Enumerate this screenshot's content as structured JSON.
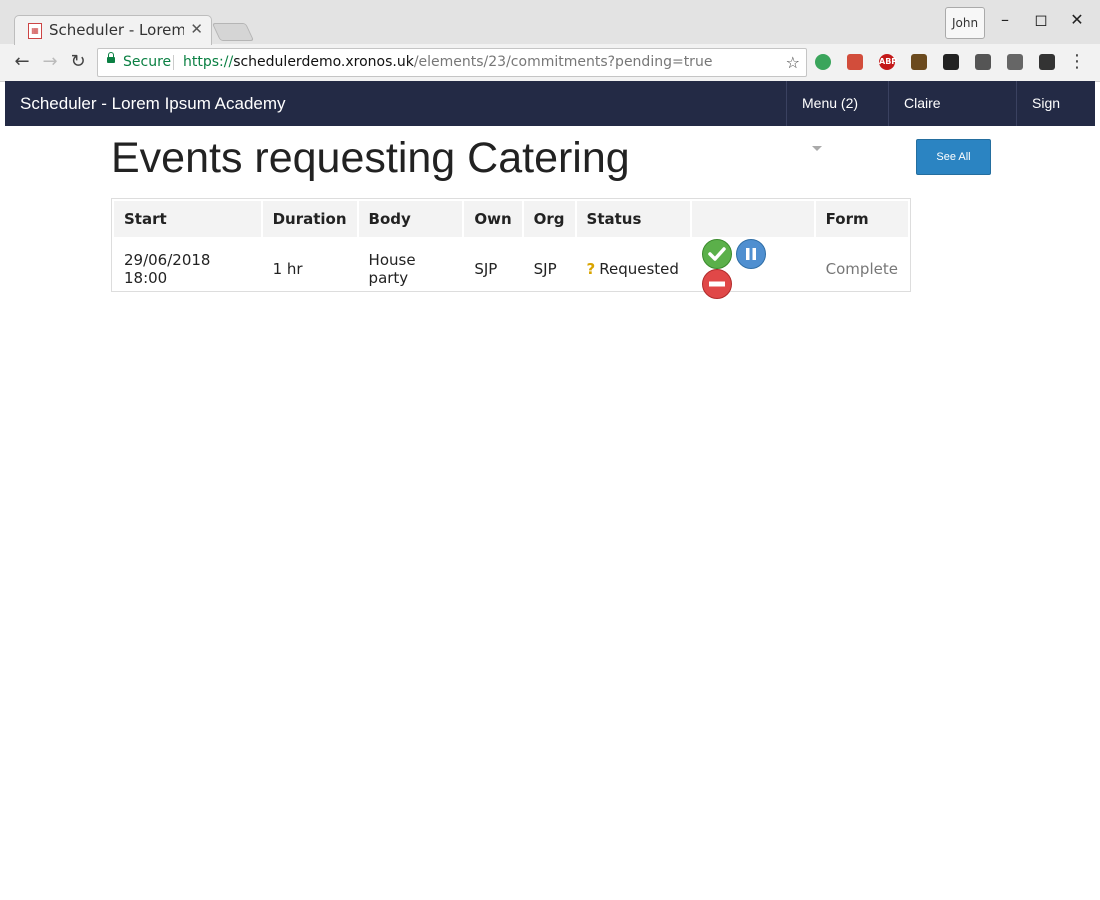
{
  "browser": {
    "tab_title": "Scheduler - Lorem Ipsum Academy",
    "profile_name": "John",
    "secure_label": "Secure",
    "url_scheme": "https://",
    "url_host": "schedulerdemo.xronos.uk",
    "url_path": "/elements/23/commitments?pending=true",
    "extensions": [
      {
        "name": "evernote-icon",
        "color": "#3ba55c"
      },
      {
        "name": "tasks-icon",
        "color": "#d24d3b"
      },
      {
        "name": "adblock-icon",
        "color": "#c41a1a",
        "label": "ABP"
      },
      {
        "name": "house-icon",
        "color": "#6b4a1e"
      },
      {
        "name": "gnome-icon",
        "color": "#222222"
      },
      {
        "name": "keeper-icon",
        "color": "#555555"
      },
      {
        "name": "mail-icon",
        "color": "#666666"
      },
      {
        "name": "screen-capture-icon",
        "color": "#333333"
      }
    ]
  },
  "app": {
    "brand": "Scheduler - Lorem Ipsum Academy",
    "nav": {
      "menu_label": "Menu (2)",
      "user_name": "Claire Dunwoody",
      "sign_out": "Sign out"
    },
    "colors": {
      "navbar_bg": "#232a45",
      "primary_button": "#2b84c2"
    }
  },
  "page": {
    "title": "Events requesting Catering",
    "see_all_label": "See All"
  },
  "table": {
    "headers": [
      "Start",
      "Duration",
      "Body",
      "Own",
      "Org",
      "Status",
      "",
      "Form"
    ],
    "rows": [
      {
        "start": "29/06/2018 18:00",
        "duration": "1 hr",
        "body": "House party",
        "own": "SJP",
        "org": "SJP",
        "status": "Requested",
        "actions": [
          "approve-icon",
          "hold-icon",
          "reject-icon"
        ],
        "form": "Complete"
      }
    ]
  }
}
